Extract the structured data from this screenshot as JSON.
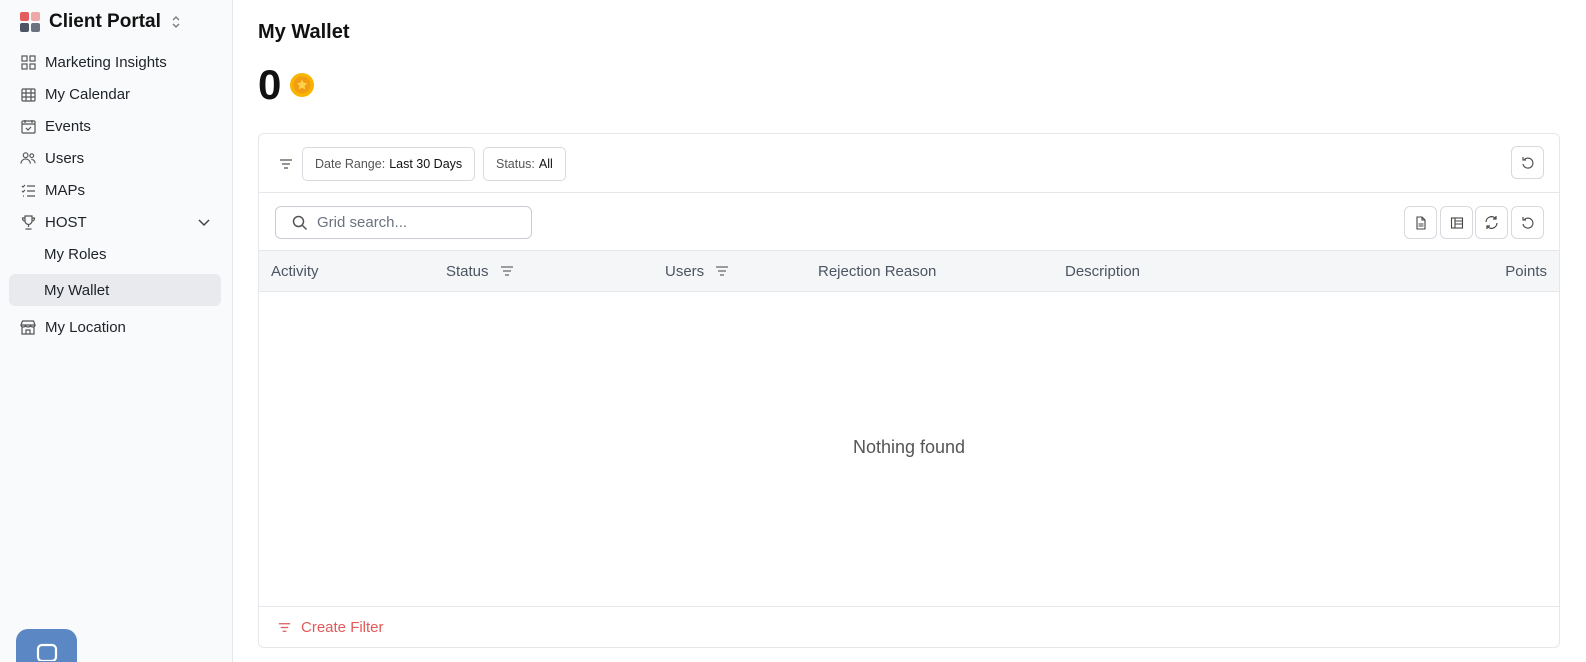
{
  "app": {
    "title": "Client Portal",
    "logo_colors": [
      "#e35d5d",
      "#f0a7a7",
      "#4b5563",
      "#6b7280"
    ]
  },
  "sidebar": {
    "items": [
      {
        "label": "Marketing Insights",
        "icon": "grid-icon"
      },
      {
        "label": "My Calendar",
        "icon": "calendar-icon"
      },
      {
        "label": "Events",
        "icon": "calendar-check-icon"
      },
      {
        "label": "Users",
        "icon": "users-icon"
      },
      {
        "label": "MAPs",
        "icon": "list-check-icon"
      },
      {
        "label": "HOST",
        "icon": "trophy-icon",
        "expanded": true,
        "children": [
          {
            "label": "My Roles"
          },
          {
            "label": "My Wallet",
            "active": true
          }
        ]
      },
      {
        "label": "My Location",
        "icon": "store-icon"
      }
    ]
  },
  "main": {
    "title": "My Wallet",
    "balance": "0",
    "coin_color": "#f7b500"
  },
  "filters": {
    "date_range": {
      "key": "Date Range:",
      "value": "Last 30 Days"
    },
    "status": {
      "key": "Status:",
      "value": "All"
    }
  },
  "search": {
    "placeholder": "Grid search..."
  },
  "table": {
    "columns": [
      "Activity",
      "Status",
      "Users",
      "Rejection Reason",
      "Description",
      "Points"
    ],
    "rows": [],
    "empty_text": "Nothing found"
  },
  "footer": {
    "create_filter_label": "Create Filter",
    "accent": "#e15a5a"
  }
}
